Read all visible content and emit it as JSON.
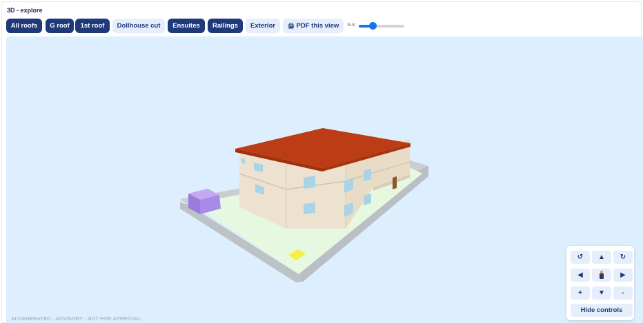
{
  "title": "3D - explore",
  "toolbar": {
    "buttons": [
      {
        "label": "All roofs",
        "style": "dark"
      },
      {
        "label": "G roof",
        "style": "dark"
      },
      {
        "label": "1st roof",
        "style": "dark"
      },
      {
        "label": "Dollhouse cut",
        "style": "light"
      },
      {
        "label": "Ensuites",
        "style": "dark"
      },
      {
        "label": "Railings",
        "style": "dark"
      },
      {
        "label": "Exterior",
        "style": "light"
      },
      {
        "label": "PDF this view",
        "style": "light",
        "icon": "printer-icon",
        "icon_glyph": "🖨"
      }
    ],
    "sun": {
      "label": "Sun",
      "value": 0.3
    }
  },
  "viewport": {
    "watermark": "AI-GENERATED - ADVISORY - NOT FOR APPROVAL"
  },
  "controls": {
    "rotate_left": "↺",
    "up": "▲",
    "rotate_right": "↻",
    "left": "◀",
    "right": "▶",
    "zoom_in": "+",
    "down": "▼",
    "zoom_out": "-",
    "walk_icon": "person-icon",
    "hide": "Hide controls"
  },
  "colors": {
    "accent": "#1e3a7b",
    "sky": "#ddeefe",
    "roof": "#b93d16",
    "walls": "#ede2cf",
    "windows": "#a9d4e8",
    "ground": "#e7f8e0",
    "boundary_wall": "#cdd2d6",
    "shed": "#a88be8",
    "marker": "#f7ee43"
  }
}
